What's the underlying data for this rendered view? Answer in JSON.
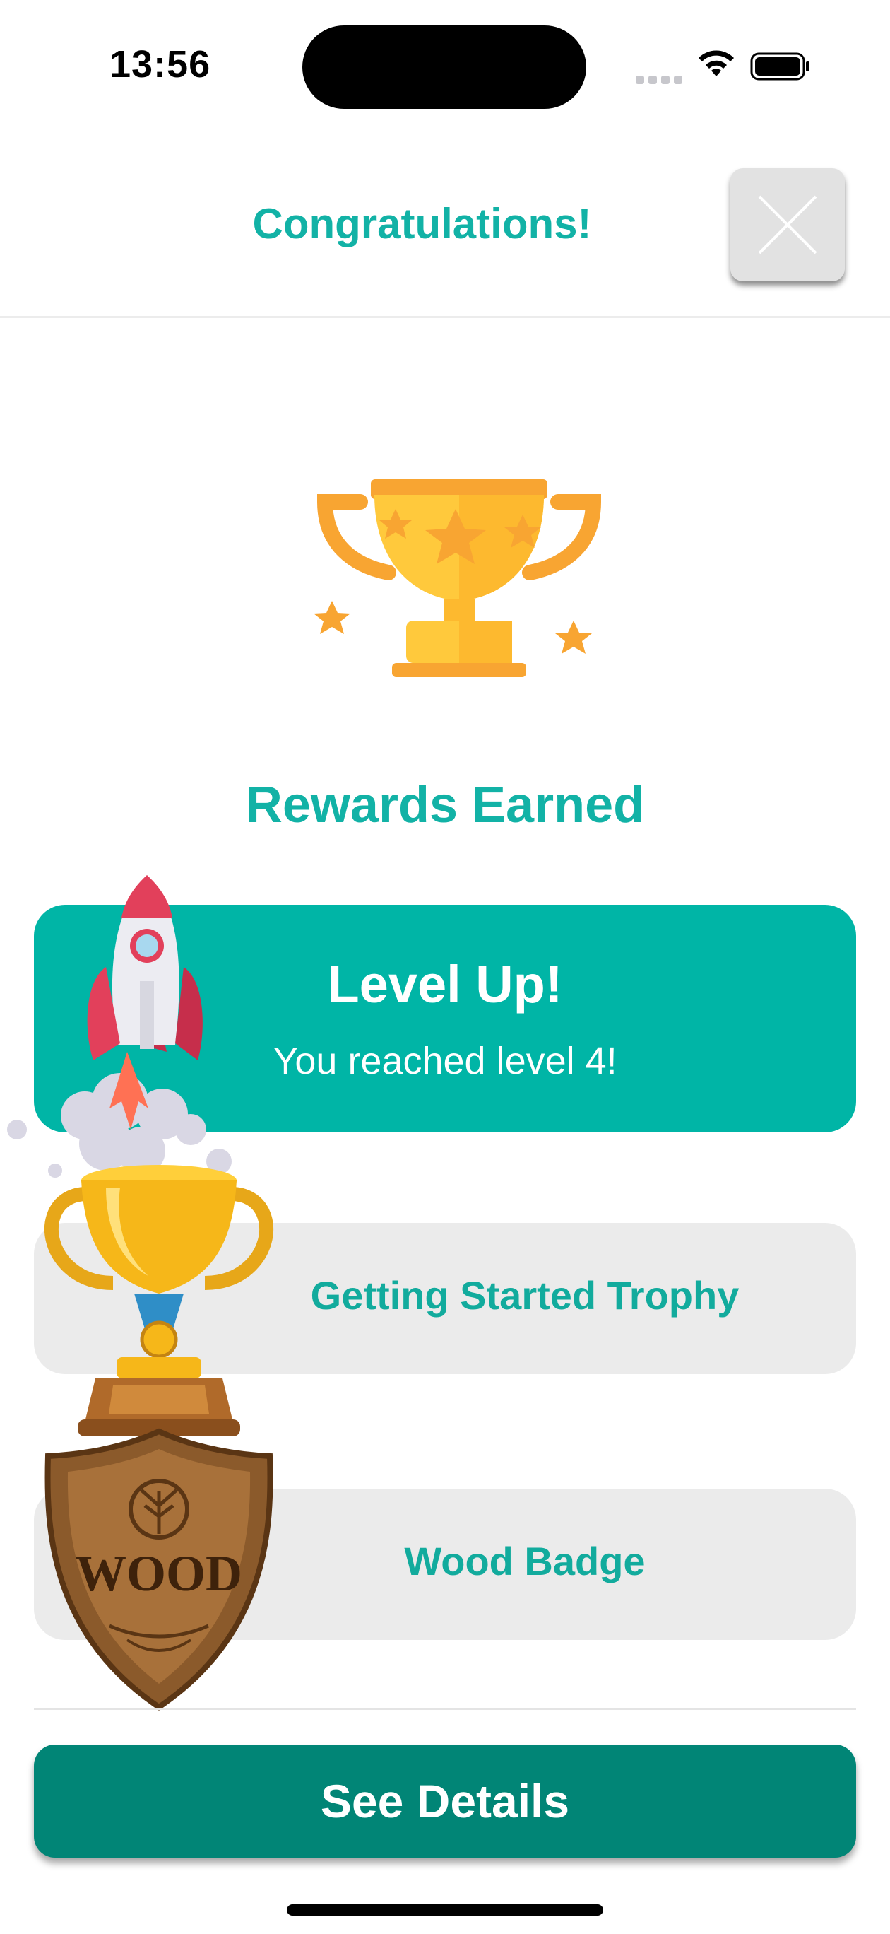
{
  "status_bar": {
    "time": "13:56"
  },
  "header": {
    "title": "Congratulations!"
  },
  "main": {
    "section_title": "Rewards Earned",
    "level_card": {
      "title": "Level Up!",
      "subtitle": "You reached level 4!"
    },
    "trophy_card": {
      "label": "Getting Started Trophy"
    },
    "badge_card": {
      "label": "Wood Badge",
      "badge_text": "WOOD"
    }
  },
  "footer": {
    "details_label": "See Details"
  },
  "colors": {
    "accent_teal": "#12b2a6",
    "card_teal": "#00b5a6",
    "button_teal": "#018576",
    "card_gray": "#ebebeb",
    "trophy_gold": "#ffc93c",
    "star_orange": "#f8a532"
  },
  "icons": [
    "close-icon",
    "trophy-icon",
    "rocket-icon",
    "gold-trophy-icon",
    "wood-badge-icon",
    "wifi-icon",
    "battery-icon",
    "cellular-icon"
  ]
}
